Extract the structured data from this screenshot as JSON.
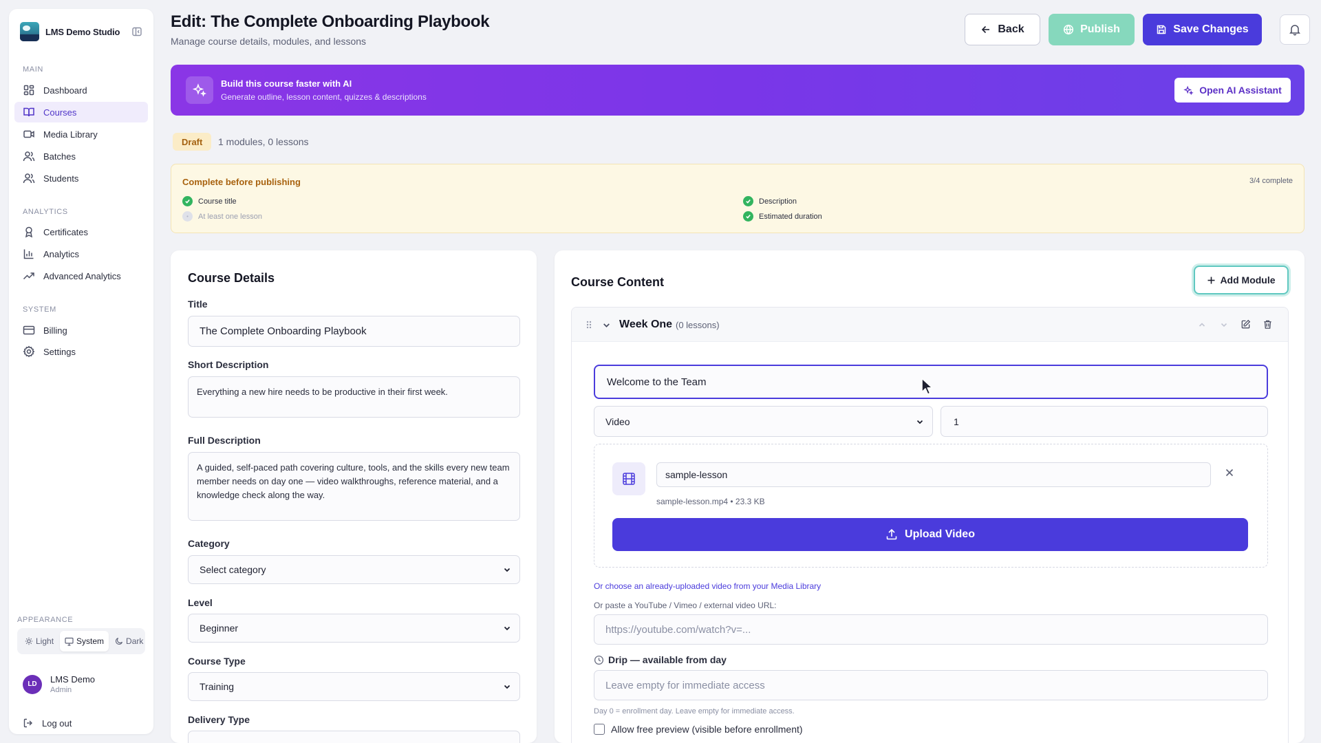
{
  "sidebar": {
    "brand": "LMS Demo Studio",
    "sections": {
      "main": "MAIN",
      "analytics": "ANALYTICS",
      "system": "SYSTEM"
    },
    "items": [
      {
        "label": "Dashboard",
        "icon": "dashboard-icon"
      },
      {
        "label": "Courses",
        "icon": "book-icon",
        "active": true
      },
      {
        "label": "Media Library",
        "icon": "video-icon"
      },
      {
        "label": "Batches",
        "icon": "users-icon"
      },
      {
        "label": "Students",
        "icon": "users-icon"
      },
      {
        "label": "Certificates",
        "icon": "award-icon"
      },
      {
        "label": "Analytics",
        "icon": "bar-chart-icon"
      },
      {
        "label": "Advanced Analytics",
        "icon": "trending-up-icon"
      },
      {
        "label": "Billing",
        "icon": "credit-card-icon"
      },
      {
        "label": "Settings",
        "icon": "gear-icon"
      }
    ],
    "appearance": {
      "label": "APPEARANCE",
      "options": [
        "Light",
        "System",
        "Dark"
      ],
      "selected": "System"
    },
    "user": {
      "initials": "LD",
      "name": "LMS Demo",
      "role": "Admin"
    },
    "logout": "Log out"
  },
  "header": {
    "title": "Edit: The Complete Onboarding Playbook",
    "subtitle": "Manage course details, modules, and lessons",
    "back": "Back",
    "publish": "Publish",
    "save": "Save Changes"
  },
  "ai_banner": {
    "title": "Build this course faster with AI",
    "subtitle": "Generate outline, lesson content, quizzes & descriptions",
    "button": "Open AI Assistant"
  },
  "status": {
    "badge": "Draft",
    "counts": "1 modules, 0 lessons"
  },
  "checklist": {
    "title": "Complete before publishing",
    "progress": "3/4 complete",
    "items": [
      {
        "label": "Course title",
        "done": true
      },
      {
        "label": "Description",
        "done": true
      },
      {
        "label": "At least one lesson",
        "done": false
      },
      {
        "label": "Estimated duration",
        "done": true
      }
    ]
  },
  "details": {
    "heading": "Course Details",
    "title_label": "Title",
    "title_value": "The Complete Onboarding Playbook",
    "short_label": "Short Description",
    "short_value": "Everything a new hire needs to be productive in their first week.",
    "full_label": "Full Description",
    "full_value": "A guided, self-paced path covering culture, tools, and the skills every new team member needs on day one — video walkthroughs, reference material, and a knowledge check along the way.",
    "category_label": "Category",
    "category_value": "Select category",
    "level_label": "Level",
    "level_value": "Beginner",
    "type_label": "Course Type",
    "type_value": "Training",
    "delivery_label": "Delivery Type"
  },
  "content": {
    "heading": "Course Content",
    "add_module": "Add Module",
    "module": {
      "name": "Week One",
      "count": "(0 lessons)"
    },
    "lesson": {
      "title_value": "Welcome to the Team",
      "type_value": "Video",
      "order_value": "1",
      "file_name": "sample-lesson",
      "file_meta": "sample-lesson.mp4 • 23.3 KB",
      "upload_button": "Upload Video",
      "media_link": "Or choose an already-uploaded video from your Media Library",
      "paste_label": "Or paste a YouTube / Vimeo / external video URL:",
      "url_placeholder": "https://youtube.com/watch?v=...",
      "drip_label": "Drip — available from day",
      "drip_placeholder": "Leave empty for immediate access",
      "drip_hint": "Day 0 = enrollment day. Leave empty for immediate access.",
      "preview_label": "Allow free preview (visible before enrollment)"
    }
  },
  "colors": {
    "accent": "#4a3bdc",
    "publish": "#86d8bd",
    "draft": "#a46110",
    "success": "#32b45f"
  }
}
